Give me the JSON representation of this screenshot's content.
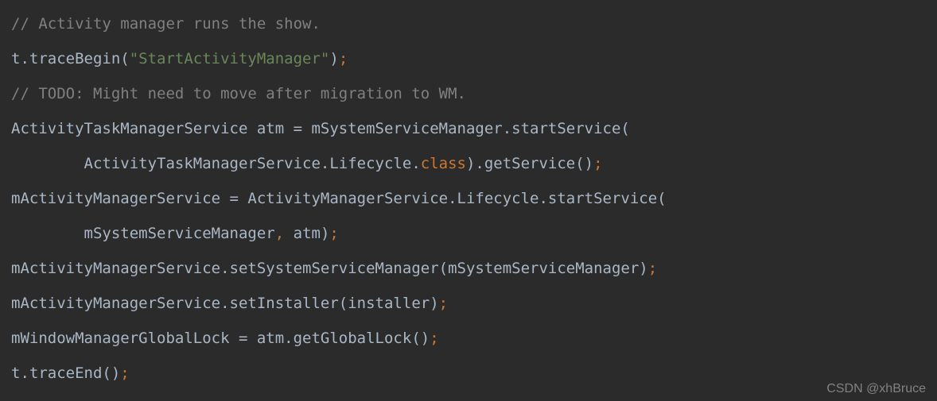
{
  "code": {
    "l1_comment": "// Activity manager runs the show.",
    "l2_a": "t.traceBegin(",
    "l2_str": "\"StartActivityManager\"",
    "l2_b": ")",
    "l2_semi": ";",
    "l3_comment": "// TODO: Might need to move after migration to WM.",
    "l4": "ActivityTaskManagerService atm = mSystemServiceManager.startService(",
    "l5_a": "        ActivityTaskManagerService.Lifecycle.",
    "l5_kw": "class",
    "l5_b": ").getService()",
    "l5_semi": ";",
    "l6": "mActivityManagerService = ActivityManagerService.Lifecycle.startService(",
    "l7_a": "        mSystemServiceManager",
    "l7_comma": ",",
    "l7_b": " atm)",
    "l7_semi": ";",
    "l8_a": "mActivityManagerService.setSystemServiceManager(mSystemServiceManager)",
    "l8_semi": ";",
    "l9_a": "mActivityManagerService.setInstaller(installer)",
    "l9_semi": ";",
    "l10_a": "mWindowManagerGlobalLock = atm.getGlobalLock()",
    "l10_semi": ";",
    "l11_a": "t.traceEnd()",
    "l11_semi": ";"
  },
  "watermark": "CSDN @xhBruce"
}
